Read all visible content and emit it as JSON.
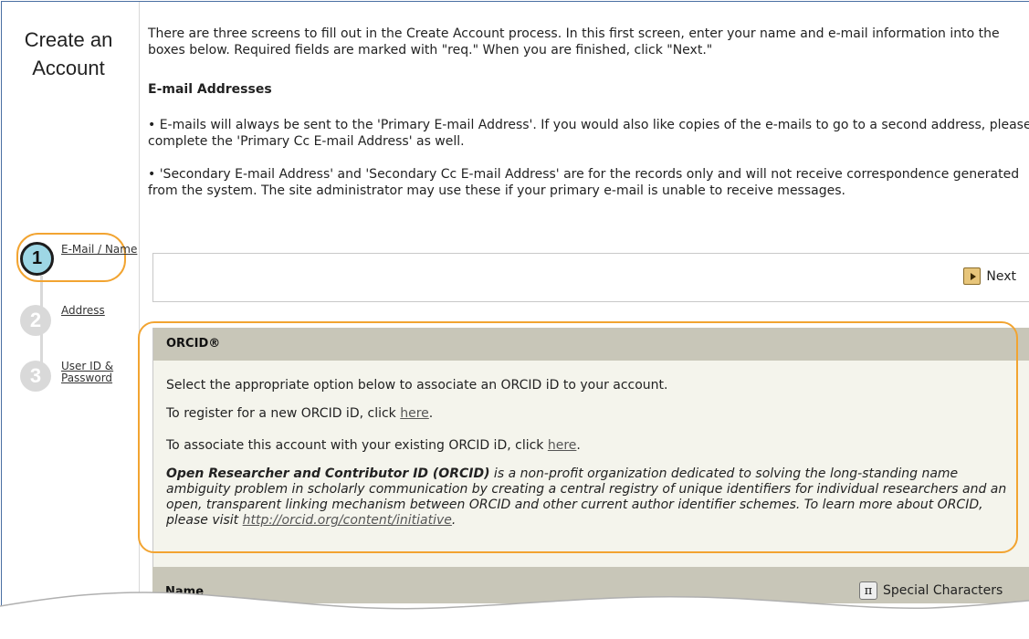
{
  "sidebar": {
    "title_line1": "Create an",
    "title_line2": "Account",
    "steps": [
      {
        "number": "1",
        "label": "E-Mail / Name"
      },
      {
        "number": "2",
        "label": "Address"
      },
      {
        "number": "3",
        "label": "User ID & Password"
      }
    ]
  },
  "main": {
    "intro": "There are three screens to fill out in the Create Account process. In this first screen, enter your name and e-mail information into the boxes below. Required fields are marked with \"req.\" When you are finished, click \"Next.\"",
    "emails_heading": "E-mail Addresses",
    "bullet1": "• E-mails will always be sent to the 'Primary E-mail Address'. If you would also like copies of the e-mails to go to a second address, please complete the 'Primary Cc E-mail Address' as well.",
    "bullet2": "• 'Secondary E-mail Address' and 'Secondary Cc E-mail Address' are for the records only and will not receive correspondence generated from the system. The site administrator may use these if your primary e-mail is unable to receive messages.",
    "next_label": "Next"
  },
  "orcid": {
    "title": "ORCID®",
    "line1": "Select the appropriate option below to associate an ORCID iD to your account.",
    "line2_prefix": "To register for a new ORCID iD, click ",
    "line2_link": "here",
    "line2_suffix": ".",
    "line3_prefix": "To associate this account with your existing ORCID iD, click ",
    "line3_link": "here",
    "line3_suffix": ".",
    "desc_bold": "Open Researcher and Contributor ID (ORCID)",
    "desc_text": " is a non-profit organization dedicated to solving the long-standing name ambiguity problem in scholarly communication by creating a central registry of unique identifiers for individual researchers and an open, transparent linking mechanism between ORCID and other current author identifier schemes. To learn more about ORCID, please visit ",
    "desc_link": "http://orcid.org/content/initiative",
    "desc_end": "."
  },
  "name_section": {
    "title": "Name",
    "special_chars_label": "Special Characters",
    "special_chars_icon": "pi-icon"
  },
  "colors": {
    "highlight": "#f2a431",
    "panel_header": "#c8c6b8",
    "panel_bg": "#f4f4ec",
    "step_active": "#9ed7e5",
    "step_inactive": "#d9d9d9"
  }
}
